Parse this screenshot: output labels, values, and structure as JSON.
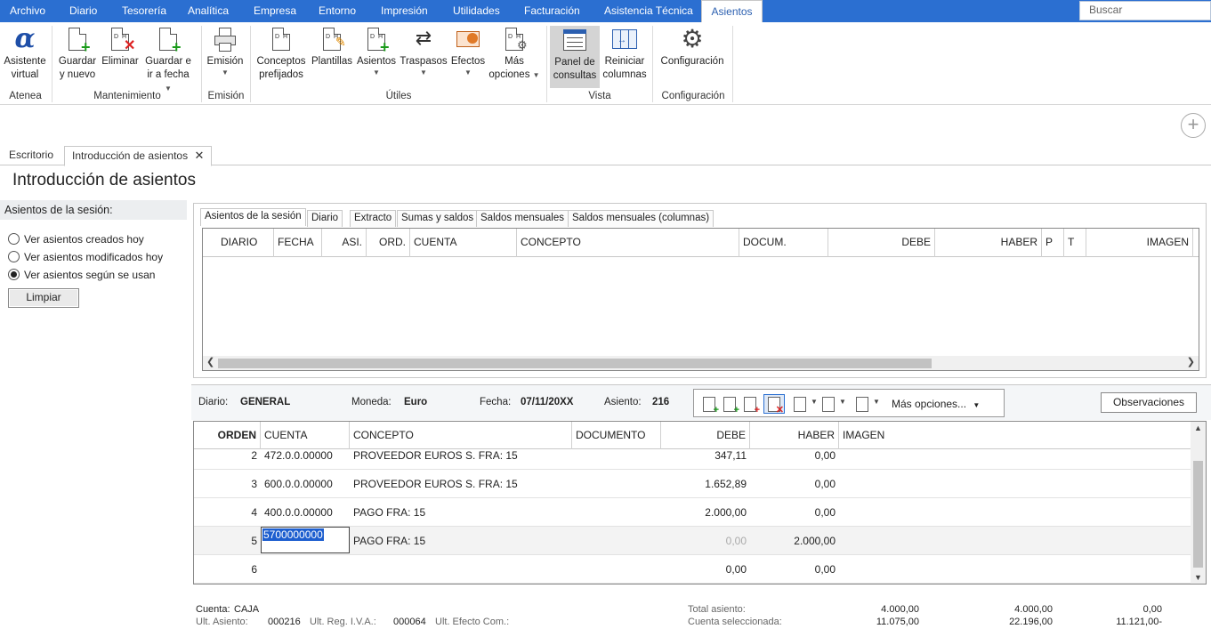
{
  "menu": {
    "tabs": [
      "Archivo",
      "Diario",
      "Tesorería",
      "Analítica",
      "Empresa",
      "Entorno",
      "Impresión",
      "Utilidades",
      "Facturación",
      "Asistencia Técnica",
      "Asientos"
    ],
    "active": "Asientos",
    "search_placeholder": "Buscar"
  },
  "ribbon": {
    "buttons": {
      "asistente": [
        "Asistente",
        "virtual"
      ],
      "guardar_nuevo": [
        "Guardar",
        "y nuevo"
      ],
      "eliminar": [
        "Eliminar"
      ],
      "guardar_fecha": [
        "Guardar e",
        "ir a fecha"
      ],
      "emision": [
        "Emisión"
      ],
      "conceptos": [
        "Conceptos",
        "prefijados"
      ],
      "plantillas": [
        "Plantillas"
      ],
      "asientos": [
        "Asientos"
      ],
      "traspasos": [
        "Traspasos"
      ],
      "efectos": [
        "Efectos"
      ],
      "mas_opciones": [
        "Más",
        "opciones"
      ],
      "panel": [
        "Panel de",
        "consultas"
      ],
      "reiniciar": [
        "Reiniciar",
        "columnas"
      ],
      "configuracion": [
        "Configuración"
      ]
    },
    "groups": {
      "atenea": "Atenea",
      "mantenimiento": "Mantenimiento",
      "emision": "Emisión",
      "utiles": "Útiles",
      "vista": "Vista",
      "configuracion": "Configuración"
    }
  },
  "doc_tabs": [
    "Escritorio",
    "Introducción de asientos"
  ],
  "page_title": "Introducción de asientos",
  "left_panel": {
    "heading": "Asientos de la sesión:",
    "options": [
      "Ver asientos creados hoy",
      "Ver asientos modificados hoy",
      "Ver asientos según se usan"
    ],
    "selected_index": 2,
    "clear_button": "Limpiar"
  },
  "session_tabs": [
    "Asientos de la sesión",
    "Diario",
    "Extracto",
    "Sumas y saldos",
    "Saldos mensuales",
    "Saldos mensuales (columnas)"
  ],
  "session_columns": [
    "DIARIO",
    "FECHA",
    "ASI.",
    "ORD.",
    "CUENTA",
    "CONCEPTO",
    "DOCUM.",
    "DEBE",
    "HABER",
    "P",
    "T",
    "IMAGEN"
  ],
  "info": {
    "diario_label": "Diario:",
    "diario": "GENERAL",
    "moneda_label": "Moneda:",
    "moneda": "Euro",
    "fecha_label": "Fecha:",
    "fecha": "07/11/20XX",
    "asiento_label": "Asiento:",
    "asiento": "216",
    "mas_opciones": "Más opciones...",
    "observaciones": "Observaciones"
  },
  "entry_columns": [
    "ORDEN",
    "CUENTA",
    "CONCEPTO",
    "DOCUMENTO",
    "DEBE",
    "HABER",
    "IMAGEN"
  ],
  "entries": [
    {
      "orden": "2",
      "cuenta": "472.0.0.00000",
      "concepto": "PROVEEDOR EUROS S. FRA:  15",
      "documento": "",
      "debe": "347,11",
      "haber": "0,00"
    },
    {
      "orden": "3",
      "cuenta": "600.0.0.00000",
      "concepto": "PROVEEDOR EUROS S. FRA:  15",
      "documento": "",
      "debe": "1.652,89",
      "haber": "0,00"
    },
    {
      "orden": "4",
      "cuenta": "400.0.0.00000",
      "concepto": "PAGO FRA: 15",
      "documento": "",
      "debe": "2.000,00",
      "haber": "0,00"
    },
    {
      "orden": "5",
      "cuenta": "5700000000",
      "concepto": "PAGO FRA: 15",
      "documento": "",
      "debe": "0,00",
      "haber": "2.000,00"
    },
    {
      "orden": "6",
      "cuenta": "",
      "concepto": "",
      "documento": "",
      "debe": "0,00",
      "haber": "0,00"
    }
  ],
  "footer": {
    "cuenta_label": "Cuenta:",
    "cuenta": "CAJA",
    "ult_asiento_label": "Ult. Asiento:",
    "ult_asiento": "000216",
    "ult_iva_label": "Ult. Reg. I.V.A.:",
    "ult_iva": "000064",
    "ult_efecto_label": "Ult. Efecto Com.:",
    "total_label": "Total asiento:",
    "total_debe": "4.000,00",
    "total_haber": "4.000,00",
    "total_saldo": "0,00",
    "sel_label": "Cuenta seleccionada:",
    "sel_debe": "11.075,00",
    "sel_haber": "22.196,00",
    "sel_saldo": "11.121,00-"
  }
}
